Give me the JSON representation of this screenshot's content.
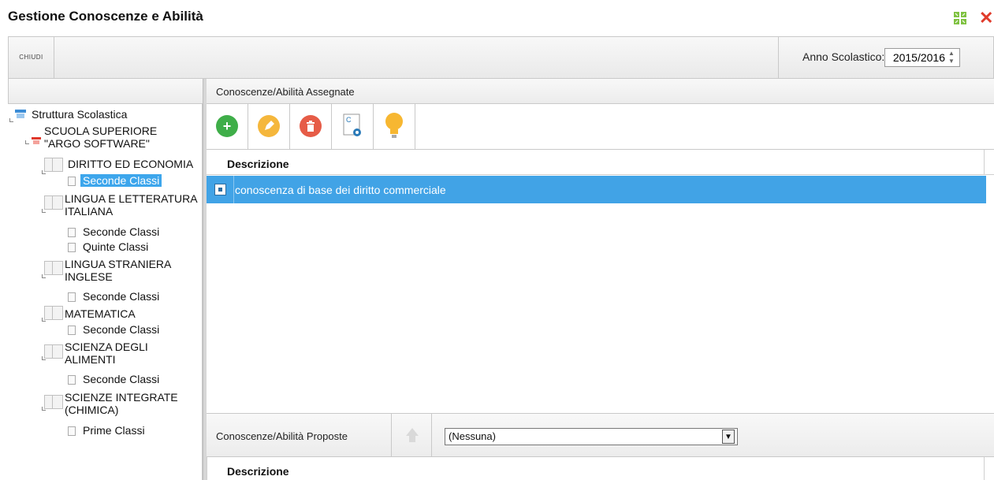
{
  "window": {
    "title": "Gestione Conoscenze e Abilità",
    "maximize_icon": "maximize-icon",
    "close_icon": "close-icon"
  },
  "toolbar": {
    "close_label": "CHIUDI",
    "year_label": "Anno Scolastico:",
    "year_value": "2015/2016"
  },
  "tree": {
    "root": "Struttura Scolastica",
    "school": "SCUOLA SUPERIORE \"ARGO SOFTWARE\"",
    "subjects": [
      {
        "name": "DIRITTO ED ECONOMIA",
        "classes": [
          "Seconde Classi"
        ]
      },
      {
        "name": "LINGUA E LETTERATURA ITALIANA",
        "classes": [
          "Seconde Classi",
          "Quinte Classi"
        ]
      },
      {
        "name": "LINGUA STRANIERA INGLESE",
        "classes": [
          "Seconde Classi"
        ]
      },
      {
        "name": "MATEMATICA",
        "classes": [
          "Seconde Classi"
        ]
      },
      {
        "name": "SCIENZA DEGLI ALIMENTI",
        "classes": [
          "Seconde Classi"
        ]
      },
      {
        "name": "SCIENZE INTEGRATE (CHIMICA)",
        "classes": [
          "Prime Classi"
        ]
      }
    ]
  },
  "assigned": {
    "title": "Conoscenze/Abilità Assegnate",
    "column_description": "Descrizione",
    "rows": [
      {
        "description": "conoscenza di base dei diritto commerciale",
        "selected": true
      }
    ],
    "actions": [
      {
        "name": "add",
        "icon": "plus-icon",
        "color": "#3fae49"
      },
      {
        "name": "edit",
        "icon": "pencil-icon",
        "color": "#f5b73c"
      },
      {
        "name": "delete",
        "icon": "trash-icon",
        "color": "#e65c47"
      },
      {
        "name": "copy",
        "icon": "copy-document-icon",
        "color": "#2a7ab8"
      },
      {
        "name": "hint",
        "icon": "lightbulb-icon",
        "color": "#f7b731"
      }
    ]
  },
  "proposed": {
    "title": "Conoscenze/Abilità Proposte",
    "select_value": "(Nessuna)",
    "column_description": "Descrizione"
  }
}
